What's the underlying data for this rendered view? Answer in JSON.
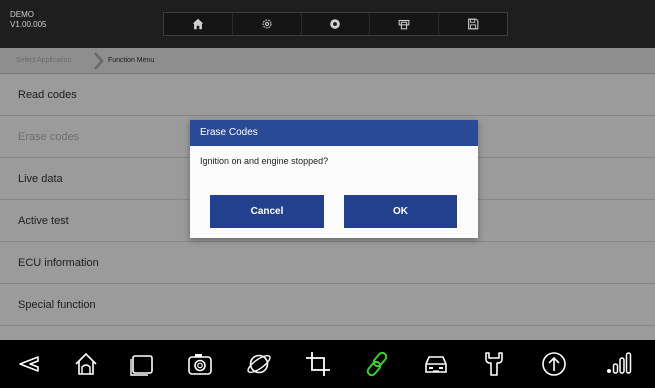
{
  "header": {
    "app_name": "DEMO",
    "version": "V1.00.005",
    "toolbar": [
      "home-icon",
      "gear-icon",
      "record-icon",
      "print-icon",
      "save-icon"
    ]
  },
  "breadcrumb": {
    "items": [
      "Select Application",
      "Function Menu"
    ]
  },
  "menu": {
    "items": [
      {
        "label": "Read codes"
      },
      {
        "label": "Erase codes"
      },
      {
        "label": "Live data"
      },
      {
        "label": "Active test"
      },
      {
        "label": "ECU information"
      },
      {
        "label": "Special function"
      }
    ]
  },
  "dialog": {
    "title": "Erase Codes",
    "message": "Ignition on and engine stopped?",
    "cancel_label": "Cancel",
    "ok_label": "OK"
  },
  "colors": {
    "dialog_title": "#2b4a96",
    "dialog_button": "#23408e",
    "link_icon": "#3bd12a"
  },
  "navbar": {
    "icons": [
      "back-icon",
      "home-icon",
      "recents-icon",
      "camera-icon",
      "browser-icon",
      "crop-icon",
      "link-icon",
      "car-icon",
      "wrench-icon",
      "upload-icon",
      "signal-icon"
    ]
  }
}
